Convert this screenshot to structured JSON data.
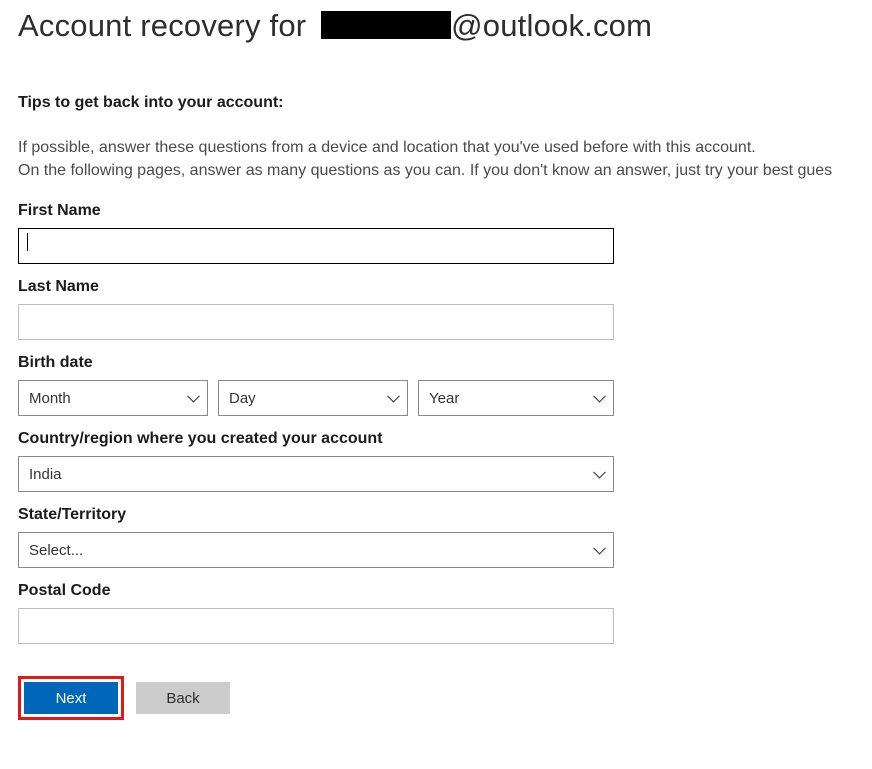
{
  "header": {
    "title_lead": "Account recovery for",
    "title_tail": "@outlook.com"
  },
  "tips": {
    "heading": "Tips to get back into your account:",
    "line1": "If possible, answer these questions from a device and location that you've used before with this account.",
    "line2": "On the following pages, answer as many questions as you can. If you don't know an answer, just try your best gues"
  },
  "form": {
    "first_name_label": "First Name",
    "first_name_value": "",
    "last_name_label": "Last Name",
    "last_name_value": "",
    "birth_date_label": "Birth date",
    "month_value": "Month",
    "day_value": "Day",
    "year_value": "Year",
    "country_label": "Country/region where you created your account",
    "country_value": "India",
    "state_label": "State/Territory",
    "state_value": "Select...",
    "postal_label": "Postal Code",
    "postal_value": ""
  },
  "buttons": {
    "next": "Next",
    "back": "Back"
  }
}
